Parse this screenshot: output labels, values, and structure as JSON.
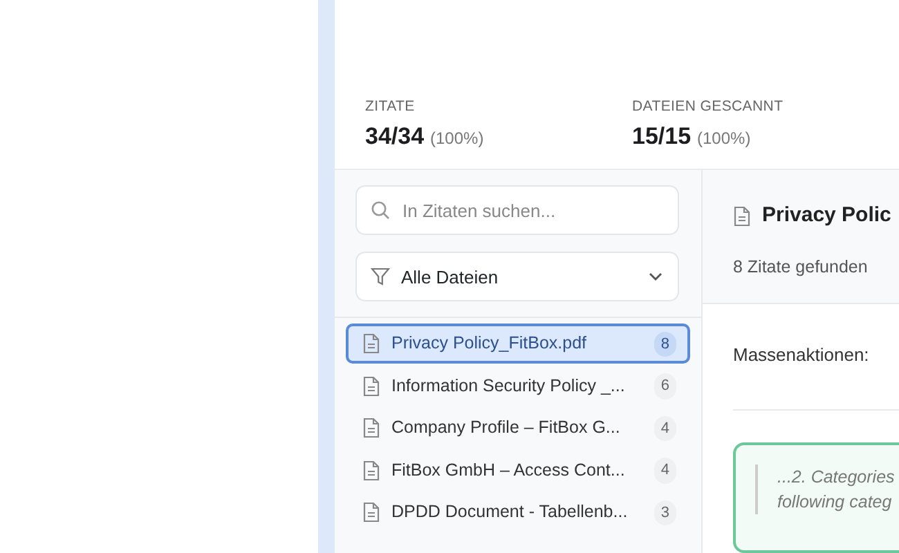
{
  "stats": [
    {
      "label": "ZITATE",
      "value": "34/34",
      "percent": "(100%)"
    },
    {
      "label": "DATEIEN GESCANNT",
      "value": "15/15",
      "percent": "(100%)"
    }
  ],
  "sidebar": {
    "search": {
      "placeholder": "In Zitaten suchen..."
    },
    "filter": {
      "value": "Alle Dateien"
    },
    "files": [
      {
        "name": "Privacy Policy_FitBox.pdf",
        "count": "8",
        "selected": true
      },
      {
        "name": "Information Security Policy _...",
        "count": "6",
        "selected": false
      },
      {
        "name": "Company Profile – FitBox G...",
        "count": "4",
        "selected": false
      },
      {
        "name": "FitBox GmbH – Access Cont...",
        "count": "4",
        "selected": false
      },
      {
        "name": "DPDD Document - Tabellenb...",
        "count": "3",
        "selected": false
      }
    ]
  },
  "detail": {
    "title": "Privacy Polic",
    "subtitle": "8 Zitate gefunden",
    "bulk_label": "Massenaktionen:",
    "quote": {
      "lines": [
        "...2. Categories",
        "following categ"
      ]
    }
  }
}
